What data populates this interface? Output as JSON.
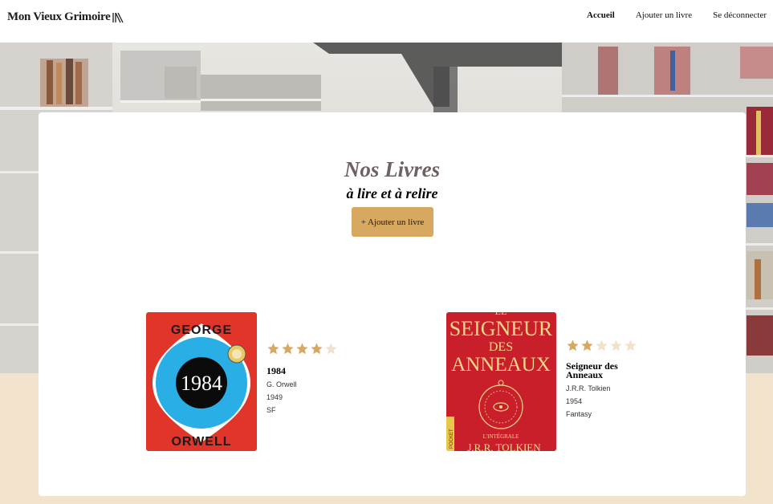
{
  "header": {
    "brand": "Mon Vieux Grimoire",
    "nav": [
      {
        "label": "Accueil",
        "active": true
      },
      {
        "label": "Ajouter un livre",
        "active": false
      },
      {
        "label": "Se déconnecter",
        "active": false
      }
    ]
  },
  "main": {
    "title": "Nos Livres",
    "subtitle": "à lire et à relire",
    "add_button": "+ Ajouter un livre"
  },
  "books": [
    {
      "title": "1984",
      "author": "G. Orwell",
      "year": "1949",
      "genre": "SF",
      "rating": 4,
      "cover": {
        "top": "GEORGE",
        "center": "1984",
        "bottom": "ORWELL"
      }
    },
    {
      "title": "Seigneur des Anneaux",
      "author": "J.R.R. Tolkien",
      "year": "1954",
      "genre": "Fantasy",
      "rating": 2,
      "cover": {
        "line1": "LE",
        "line2": "SEIGNEUR",
        "line3": "DES",
        "line4": "ANNEAUX",
        "edition": "L'INTÉGRALE",
        "author": "J.R.R. TOLKIEN",
        "spine": "POCKET"
      }
    }
  ],
  "colors": {
    "accent": "#d7a860",
    "star_filled": "#d7a860",
    "star_empty": "#f0e2cb",
    "title": "#6f6062",
    "footer_bg": "#f1e3cc"
  }
}
